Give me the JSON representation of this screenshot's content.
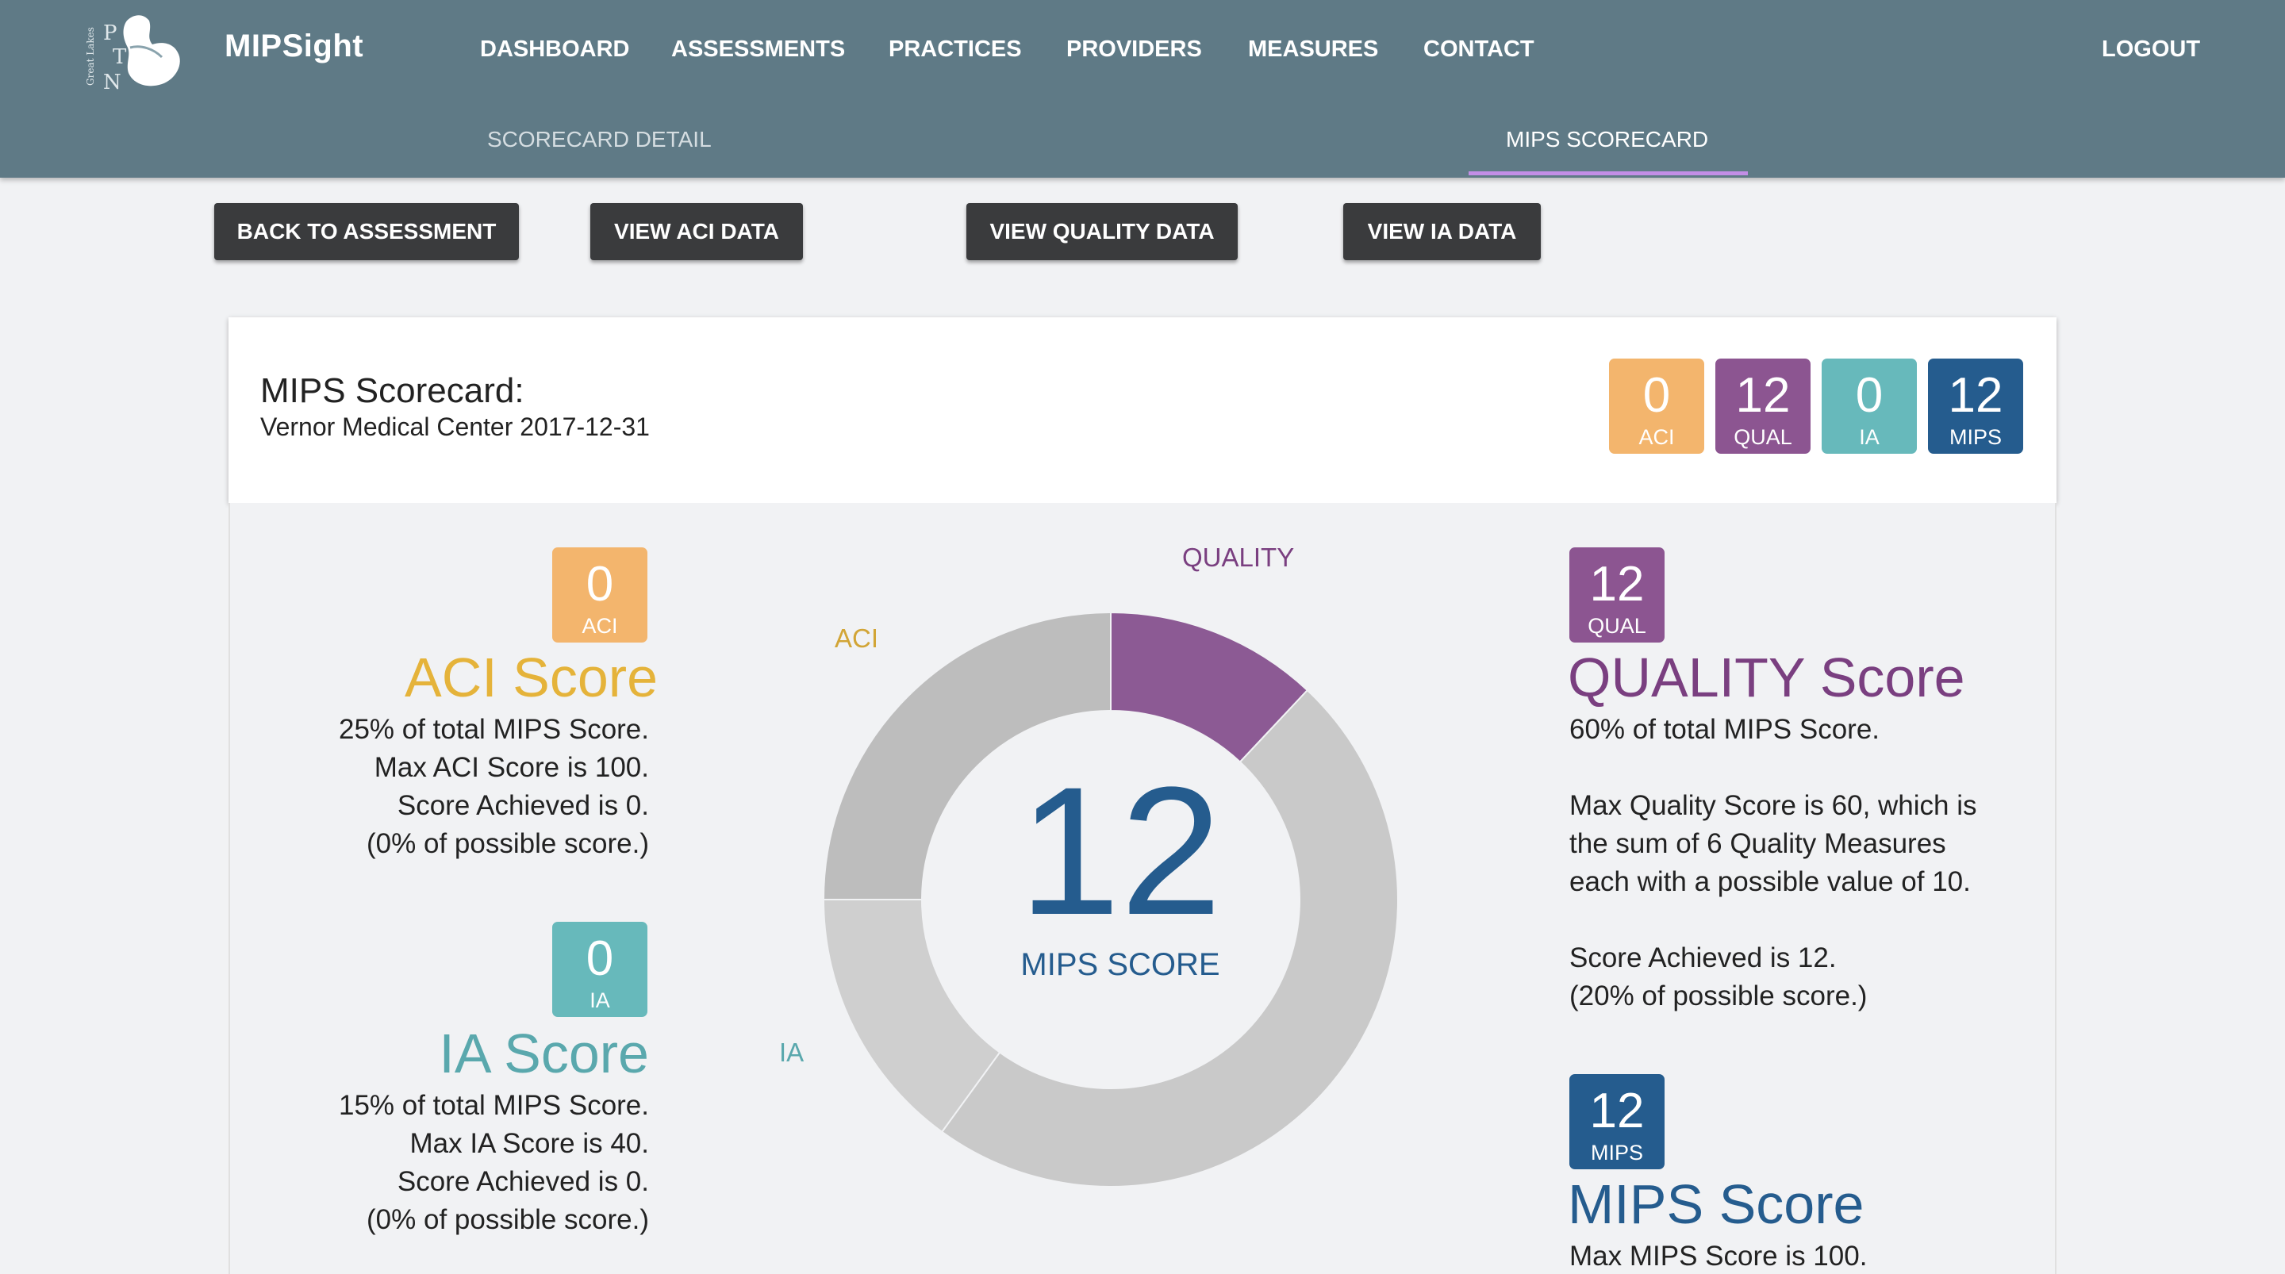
{
  "app": {
    "brand": "MIPSight",
    "logo_text": "Great Lakes PTN"
  },
  "nav": [
    {
      "label": "DASHBOARD"
    },
    {
      "label": "ASSESSMENTS"
    },
    {
      "label": "PRACTICES"
    },
    {
      "label": "PROVIDERS"
    },
    {
      "label": "MEASURES"
    },
    {
      "label": "CONTACT"
    }
  ],
  "logout_label": "LOGOUT",
  "subtabs": {
    "detail": "SCORECARD DETAIL",
    "mips": "MIPS SCORECARD",
    "active": "mips"
  },
  "buttons": {
    "back": "BACK TO ASSESSMENT",
    "aci": "VIEW ACI DATA",
    "quality": "VIEW QUALITY DATA",
    "ia": "VIEW IA DATA"
  },
  "scorecard": {
    "title": "MIPS Scorecard:",
    "subtitle": "Vernor Medical Center 2017-12-31"
  },
  "badges": {
    "aci": {
      "value": "0",
      "label": "ACI",
      "color": "#f3b56d"
    },
    "qual": {
      "value": "12",
      "label": "QUAL",
      "color": "#8c5591"
    },
    "ia": {
      "value": "0",
      "label": "IA",
      "color": "#67b9bb"
    },
    "mips": {
      "value": "12",
      "label": "MIPS",
      "color": "#255c8e"
    }
  },
  "aci": {
    "title": "ACI Score",
    "color": "#e5b33a",
    "lines": [
      "25% of total MIPS Score.",
      "Max ACI Score is 100.",
      "Score Achieved is 0.",
      "(0% of possible score.)"
    ]
  },
  "ia": {
    "title": "IA Score",
    "color": "#5aa8ad",
    "lines": [
      "15% of total MIPS Score.",
      "Max IA Score is 40.",
      "Score Achieved is 0.",
      "(0% of possible score.)"
    ]
  },
  "quality": {
    "title": "QUALITY Score",
    "color": "#7a3f80",
    "line1": "60% of total MIPS Score.",
    "lines2": [
      "Max Quality Score is 60, which is",
      "the sum of 6 Quality Measures",
      "each with a possible value of 10."
    ],
    "lines3": [
      "Score Achieved is 12.",
      "(20% of possible score.)"
    ]
  },
  "mips": {
    "title": "MIPS Score",
    "color": "#255c8e",
    "line1": "Max MIPS Score is 100."
  },
  "chart_data": {
    "type": "pie",
    "variant": "donut",
    "center_value": "12",
    "center_label": "MIPS SCORE",
    "slices": [
      {
        "label": "QUALITY",
        "value": 12,
        "color": "#8c5a94",
        "label_color": "#7a3f80"
      },
      {
        "label": "",
        "value": 48,
        "color": "#c9c9c9"
      },
      {
        "label": "IA",
        "value": 15,
        "color": "#cfcfcf",
        "label_color": "#5aa8ad"
      },
      {
        "label": "ACI",
        "value": 25,
        "color": "#bdbdbd",
        "label_color": "#d2a536"
      }
    ]
  }
}
